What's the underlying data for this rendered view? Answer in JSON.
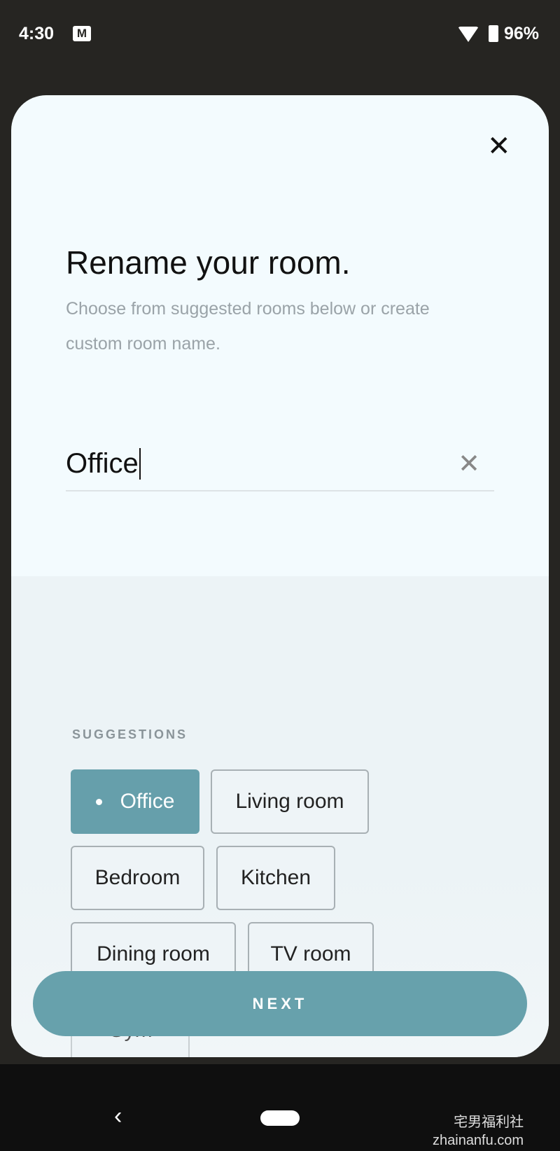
{
  "status": {
    "time": "4:30",
    "battery": "96%",
    "icons": [
      "gmail-icon",
      "wifi-icon",
      "battery-icon"
    ]
  },
  "dialog": {
    "title": "Rename your room.",
    "subtitle": "Choose from suggested rooms below or create custom room name.",
    "input_value": "Office",
    "suggestions_label": "SUGGESTIONS",
    "suggestions": [
      {
        "label": "Office",
        "selected": true
      },
      {
        "label": "Living room"
      },
      {
        "label": "Bedroom"
      },
      {
        "label": "Kitchen"
      },
      {
        "label": "Dining room"
      },
      {
        "label": "TV room"
      },
      {
        "label": "Gym"
      }
    ],
    "next_label": "NEXT"
  },
  "watermark": {
    "cn": "宅男福利社",
    "url": "zhainanfu.com"
  },
  "colors": {
    "accent": "#67a1ac",
    "card": "#f3fbfe"
  }
}
